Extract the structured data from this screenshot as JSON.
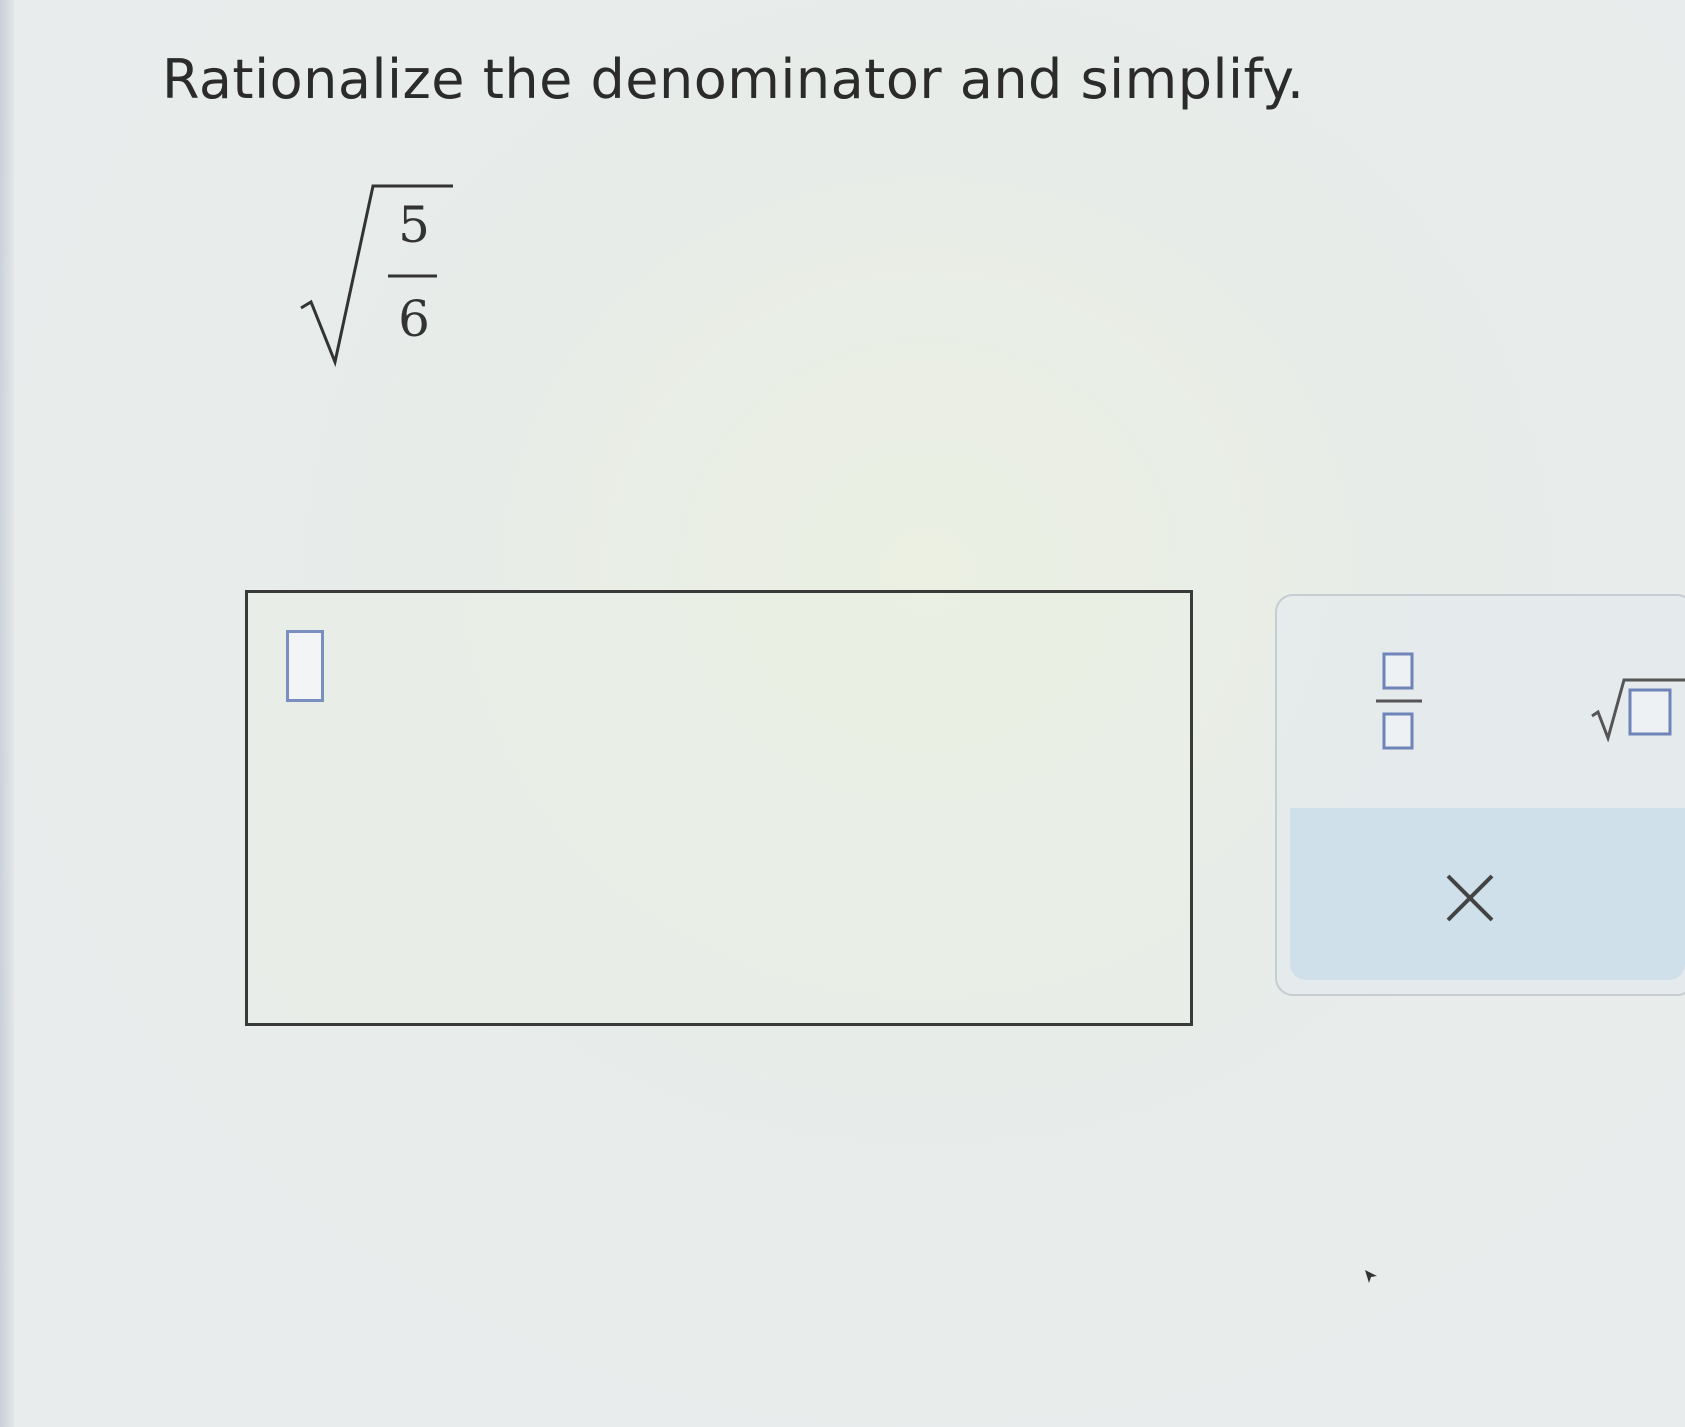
{
  "question": {
    "prompt": "Rationalize the denominator and simplify.",
    "expression": {
      "type": "sqrt_fraction",
      "numerator": "5",
      "denominator": "6"
    }
  },
  "answer": {
    "value": ""
  },
  "toolbar": {
    "fraction_icon": "fraction-template-icon",
    "sqrt_icon": "sqrt-template-icon",
    "clear_icon": "close-icon"
  },
  "colors": {
    "background": "#e9ecec",
    "slot_border": "#7a8fc0",
    "toolbar_lower": "#cfe0ea"
  }
}
